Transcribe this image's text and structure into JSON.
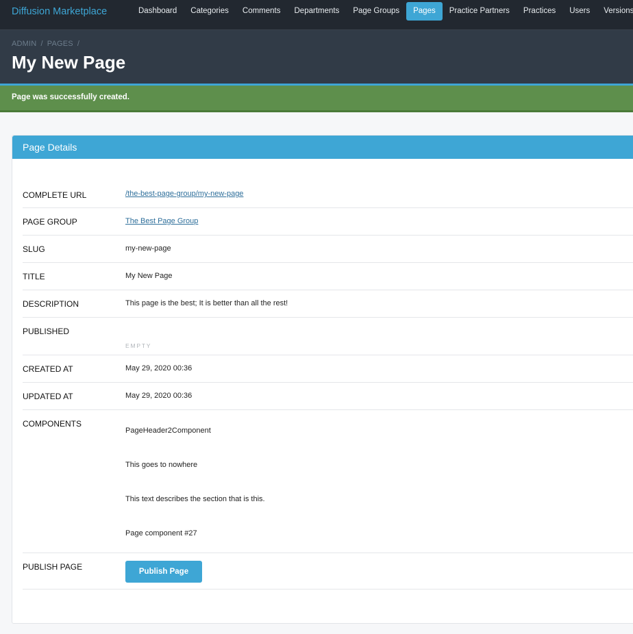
{
  "navbar": {
    "brand": "Diffusion Marketplace",
    "items": [
      {
        "label": "Dashboard",
        "active": false
      },
      {
        "label": "Categories",
        "active": false
      },
      {
        "label": "Comments",
        "active": false
      },
      {
        "label": "Departments",
        "active": false
      },
      {
        "label": "Page Groups",
        "active": false
      },
      {
        "label": "Pages",
        "active": true
      },
      {
        "label": "Practice Partners",
        "active": false
      },
      {
        "label": "Practices",
        "active": false
      },
      {
        "label": "Users",
        "active": false
      },
      {
        "label": "Versions",
        "active": false
      }
    ]
  },
  "breadcrumb": [
    "ADMIN",
    "/",
    "PAGES",
    "/"
  ],
  "page_title": "My New Page",
  "flash": "Page was successfully created.",
  "panel": {
    "title": "Page Details",
    "fields": {
      "complete_url": {
        "label": "COMPLETE URL",
        "value": "/the-best-page-group/my-new-page"
      },
      "page_group": {
        "label": "PAGE GROUP",
        "value": "The Best Page Group"
      },
      "slug": {
        "label": "SLUG",
        "value": "my-new-page"
      },
      "title": {
        "label": "TITLE",
        "value": "My New Page"
      },
      "description": {
        "label": "DESCRIPTION",
        "value": "This page is the best; It is better than all the rest!"
      },
      "published": {
        "label": "PUBLISHED",
        "value": "EMPTY"
      },
      "created_at": {
        "label": "CREATED AT",
        "value": "May 29, 2020 00:36"
      },
      "updated_at": {
        "label": "UPDATED AT",
        "value": "May 29, 2020 00:36"
      },
      "components": {
        "label": "COMPONENTS",
        "items": [
          "PageHeader2Component",
          "This goes to nowhere",
          "This text describes the section that is this.",
          "Page component #27"
        ]
      },
      "publish_page": {
        "label": "PUBLISH PAGE",
        "button": "Publish Page"
      }
    }
  },
  "colors": {
    "accent": "#3ea6d5",
    "navbar_bg": "#222830",
    "hero_bg": "#313b47",
    "success": "#5e8f4c"
  }
}
